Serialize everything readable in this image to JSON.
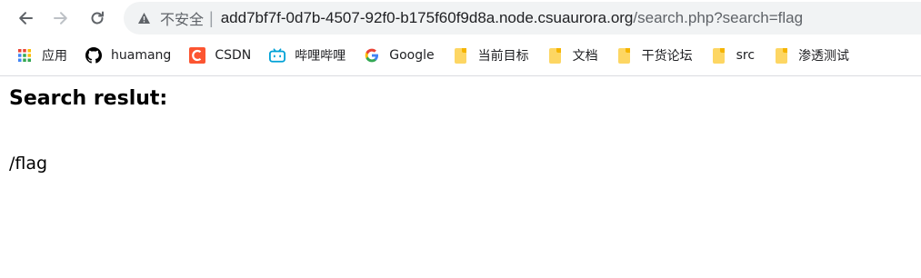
{
  "browser": {
    "security_label": "不安全",
    "separator": "|",
    "url_host": "add7bf7f-0d7b-4507-92f0-b175f60f9d8a.node.csuaurora.org",
    "url_path": "/search.php?search=flag",
    "nav_icons": [
      "back-arrow-icon",
      "forward-arrow-icon",
      "reload-icon",
      "warning-icon"
    ]
  },
  "bookmarks": {
    "items": [
      {
        "label": "应用",
        "icon": "apps-grid-icon"
      },
      {
        "label": "huamang",
        "icon": "github-icon"
      },
      {
        "label": "CSDN",
        "icon": "csdn-icon"
      },
      {
        "label": "哔哩哔哩",
        "icon": "bilibili-icon"
      },
      {
        "label": "Google",
        "icon": "google-icon"
      },
      {
        "label": "当前目标",
        "icon": "folder-icon"
      },
      {
        "label": "文档",
        "icon": "folder-icon"
      },
      {
        "label": "干货论坛",
        "icon": "folder-icon"
      },
      {
        "label": "src",
        "icon": "folder-icon"
      },
      {
        "label": "渗透测试",
        "icon": "folder-icon"
      }
    ],
    "colors": {
      "csdn": "#fc5531",
      "bilibili": "#00a1d6",
      "folder": "#fdd663"
    }
  },
  "page": {
    "heading": "Search reslut:",
    "result": "/flag"
  }
}
